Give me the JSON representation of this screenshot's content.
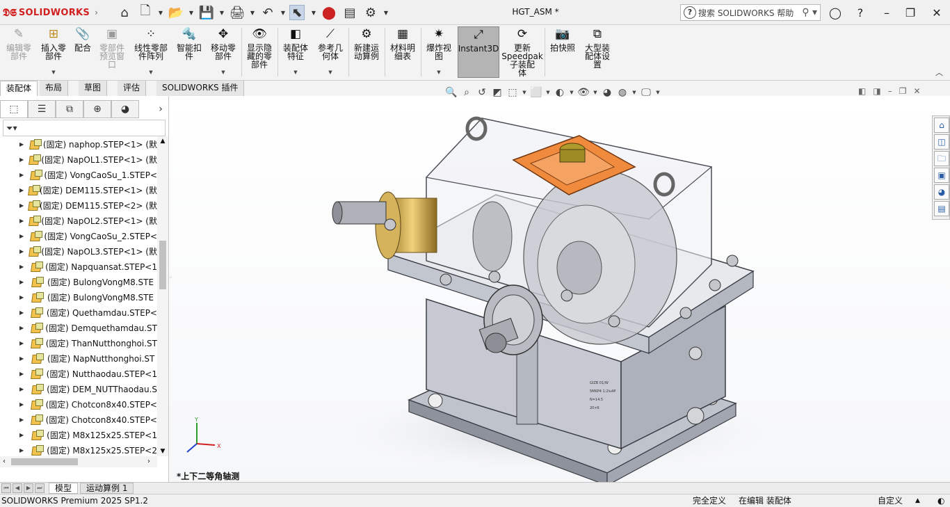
{
  "app": {
    "brand": "SOLIDWORKS",
    "title": "HGT_ASM *"
  },
  "search": {
    "placeholder": "搜索 SOLIDWORKS 帮助"
  },
  "ribbon": {
    "buttons": [
      {
        "label": "编辑零\n部件",
        "icon": "edit-component-icon",
        "disabled": true
      },
      {
        "label": "插入零\n部件",
        "icon": "insert-component-icon"
      },
      {
        "label": "配合",
        "icon": "mate-icon"
      },
      {
        "label": "零部件\n预览窗\n口",
        "icon": "preview-window-icon",
        "disabled": true
      },
      {
        "label": "线性零部\n件阵列",
        "icon": "linear-pattern-icon"
      },
      {
        "label": "智能扣\n件",
        "icon": "smart-fastener-icon"
      },
      {
        "label": "移动零\n部件",
        "icon": "move-component-icon"
      },
      {
        "label": "显示隐\n藏的零\n部件",
        "icon": "show-hidden-icon"
      },
      {
        "label": "装配体\n特征",
        "icon": "assembly-feature-icon"
      },
      {
        "label": "参考几\n何体",
        "icon": "reference-geometry-icon"
      },
      {
        "label": "新建运\n动算例",
        "icon": "motion-study-icon"
      },
      {
        "label": "材料明\n细表",
        "icon": "bom-icon"
      },
      {
        "label": "爆炸视\n图",
        "icon": "exploded-view-icon"
      },
      {
        "label": "Instant3D",
        "icon": "instant3d-icon"
      },
      {
        "label": "更新\nSpeedpak\n子装配\n体",
        "icon": "speedpak-icon"
      },
      {
        "label": "拍快照",
        "icon": "snapshot-icon"
      },
      {
        "label": "大型装\n配体设\n置",
        "icon": "large-assembly-icon"
      }
    ]
  },
  "tabs": [
    "装配体",
    "布局",
    "草图",
    "评估",
    "SOLIDWORKS 插件"
  ],
  "tree": {
    "items": [
      {
        "text": "(固定) naphop.STEP<1> (默"
      },
      {
        "text": "(固定) NapOL1.STEP<1> (默"
      },
      {
        "text": "(固定) VongCaoSu_1.STEP<"
      },
      {
        "text": "(固定) DEM115.STEP<1> (默"
      },
      {
        "text": "(固定) DEM115.STEP<2> (默"
      },
      {
        "text": "(固定) NapOL2.STEP<1> (默"
      },
      {
        "text": "(固定) VongCaoSu_2.STEP<"
      },
      {
        "text": "(固定) NapOL3.STEP<1> (默"
      },
      {
        "text": "(固定) Napquansat.STEP<1"
      },
      {
        "text": "(固定) BulongVongM8.STE"
      },
      {
        "text": "(固定) BulongVongM8.STE"
      },
      {
        "text": "(固定) Quethamdau.STEP<"
      },
      {
        "text": "(固定) Demquethamdau.ST"
      },
      {
        "text": "(固定) ThanNutthonghoi.ST"
      },
      {
        "text": "(固定) NapNutthonghoi.ST"
      },
      {
        "text": "(固定) Nutthaodau.STEP<1"
      },
      {
        "text": "(固定) DEM_NUTThaodau.S"
      },
      {
        "text": "(固定) Chotcon8x40.STEP<"
      },
      {
        "text": "(固定) Chotcon8x40.STEP<"
      },
      {
        "text": "(固定) M8x125x25.STEP<1"
      },
      {
        "text": "(固定) M8x125x25.STEP<2"
      }
    ]
  },
  "viewport": {
    "view_name": "*上下二等角轴测",
    "triad": {
      "x": "X",
      "y": "Y"
    },
    "part_marking": [
      "GIZB 01/W",
      "5MKP4 1:2lu4P",
      "N=14.5",
      "20×6"
    ]
  },
  "bottom_tabs": [
    "模型",
    "运动算例 1"
  ],
  "status": {
    "product": "SOLIDWORKS Premium 2025 SP1.2",
    "definition": "完全定义",
    "editing": "在编辑 装配体",
    "units": "自定义"
  },
  "colors": {
    "accent": "#d21f1f",
    "highlight_plate": "#f08a3c",
    "housing": "#cfd2d8"
  }
}
